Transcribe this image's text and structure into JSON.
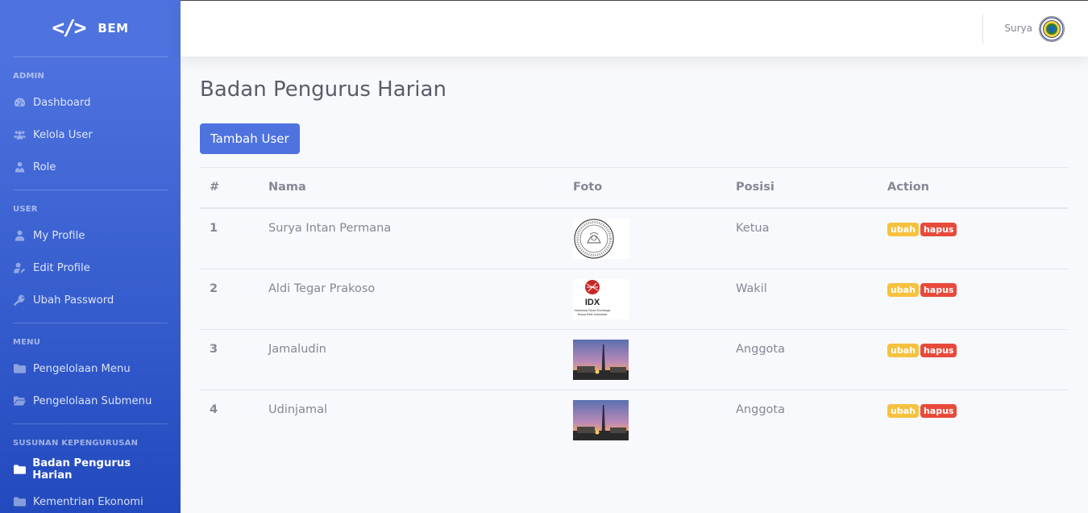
{
  "brand": {
    "icon": "code-icon",
    "name": "BEM"
  },
  "sidebar": {
    "sections": [
      {
        "heading": "ADMIN",
        "items": [
          {
            "label": "Dashboard",
            "icon": "tachometer-icon"
          },
          {
            "label": "Kelola User",
            "icon": "users-icon"
          },
          {
            "label": "Role",
            "icon": "user-tie-icon"
          }
        ]
      },
      {
        "heading": "USER",
        "items": [
          {
            "label": "My Profile",
            "icon": "user-icon"
          },
          {
            "label": "Edit Profile",
            "icon": "user-edit-icon"
          },
          {
            "label": "Ubah Password",
            "icon": "key-icon"
          }
        ]
      },
      {
        "heading": "MENU",
        "items": [
          {
            "label": "Pengelolaan Menu",
            "icon": "folder-icon"
          },
          {
            "label": "Pengelolaan Submenu",
            "icon": "folder-open-icon"
          }
        ]
      },
      {
        "heading": "SUSUNAN KEPENGURUSAN",
        "items": [
          {
            "label": "Badan Pengurus Harian",
            "icon": "folder-icon",
            "active": true
          },
          {
            "label": "Kementrian Ekonomi",
            "icon": "folder-icon"
          }
        ]
      }
    ]
  },
  "topbar": {
    "user_name": "Surya",
    "avatar_icon": "university-logo-icon"
  },
  "page": {
    "title": "Badan Pengurus Harian",
    "add_button": "Tambah User"
  },
  "table": {
    "headers": [
      "#",
      "Nama",
      "Foto",
      "Posisi",
      "Action"
    ],
    "rows": [
      {
        "no": "1",
        "nama": "Surya Intan Permana",
        "foto": "university-seal-image",
        "posisi": "Ketua",
        "edit": "ubah",
        "delete": "hapus"
      },
      {
        "no": "2",
        "nama": "Aldi Tegar Prakoso",
        "foto": "idx-logo-image",
        "posisi": "Wakil",
        "edit": "ubah",
        "delete": "hapus"
      },
      {
        "no": "3",
        "nama": "Jamaludin",
        "foto": "tower-photo-image",
        "posisi": "Anggota",
        "edit": "ubah",
        "delete": "hapus"
      },
      {
        "no": "4",
        "nama": "Udinjamal",
        "foto": "tower-photo-image",
        "posisi": "Anggota",
        "edit": "ubah",
        "delete": "hapus"
      }
    ],
    "idx_text": "IDX",
    "idx_subtitle": "Indonesia Stock Exchange",
    "idx_subtitle2": "Bursa Efek Indonesia"
  },
  "colors": {
    "primary": "#4e73df",
    "warning": "#f6c23e",
    "danger": "#e74a3b"
  }
}
